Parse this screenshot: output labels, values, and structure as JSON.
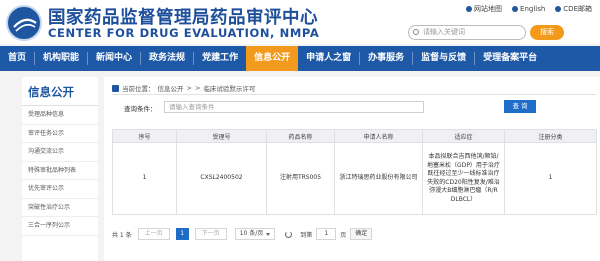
{
  "header": {
    "title": "国家药品监督管理局药品审评中心",
    "subtitle": "CENTER FOR DRUG EVALUATION, NMPA",
    "links": [
      "网站地图",
      "English",
      "CDE邮箱"
    ],
    "search_placeholder": "请输入关键词",
    "search_button": "搜索"
  },
  "nav": {
    "items": [
      "首页",
      "机构职能",
      "新闻中心",
      "政务法规",
      "党建工作",
      "信息公开",
      "申请人之窗",
      "办事服务",
      "监督与反馈",
      "受理备案平台"
    ],
    "active_index": 5
  },
  "sidebar": {
    "title": "信息公开",
    "items": [
      "受理品种信息",
      "审评任务公示",
      "沟通交流公示",
      "特殊审批品种列表",
      "优先审评公示",
      "突破性治疗公示",
      "三合一序列公示"
    ]
  },
  "breadcrumb": {
    "prefix": "当前位置：",
    "parts": [
      "信息公开",
      ">",
      ">",
      "临床试验默示许可"
    ]
  },
  "filter": {
    "label": "查询条件：",
    "placeholder": "请输入查询条件",
    "button": "查 询"
  },
  "table": {
    "headers": [
      "序号",
      "受理号",
      "药品名称",
      "申请人名称",
      "适应症",
      "注册分类"
    ],
    "rows": [
      [
        "1",
        "CXSL2400502",
        "注射用TRS005",
        "浙江特瑞思药业股份有限公司",
        "本品拟联合吉西他滨/顺铂/地塞米松（GDP）用于治疗既往经过至少一线标准治疗失败的CD20阳性复发/难治弥漫大B细胞淋巴瘤（R/R DLBCL）",
        "1"
      ]
    ]
  },
  "pager": {
    "total": "共 1 条",
    "prev": "上一页",
    "current": "1",
    "next": "下一页",
    "page_size": "10 条/页",
    "goto_label": "到第",
    "goto_value": "1",
    "page_unit": "页",
    "confirm": "确定"
  },
  "colors": {
    "brand_blue": "#1e59a8",
    "active_orange": "#f29a1e"
  }
}
